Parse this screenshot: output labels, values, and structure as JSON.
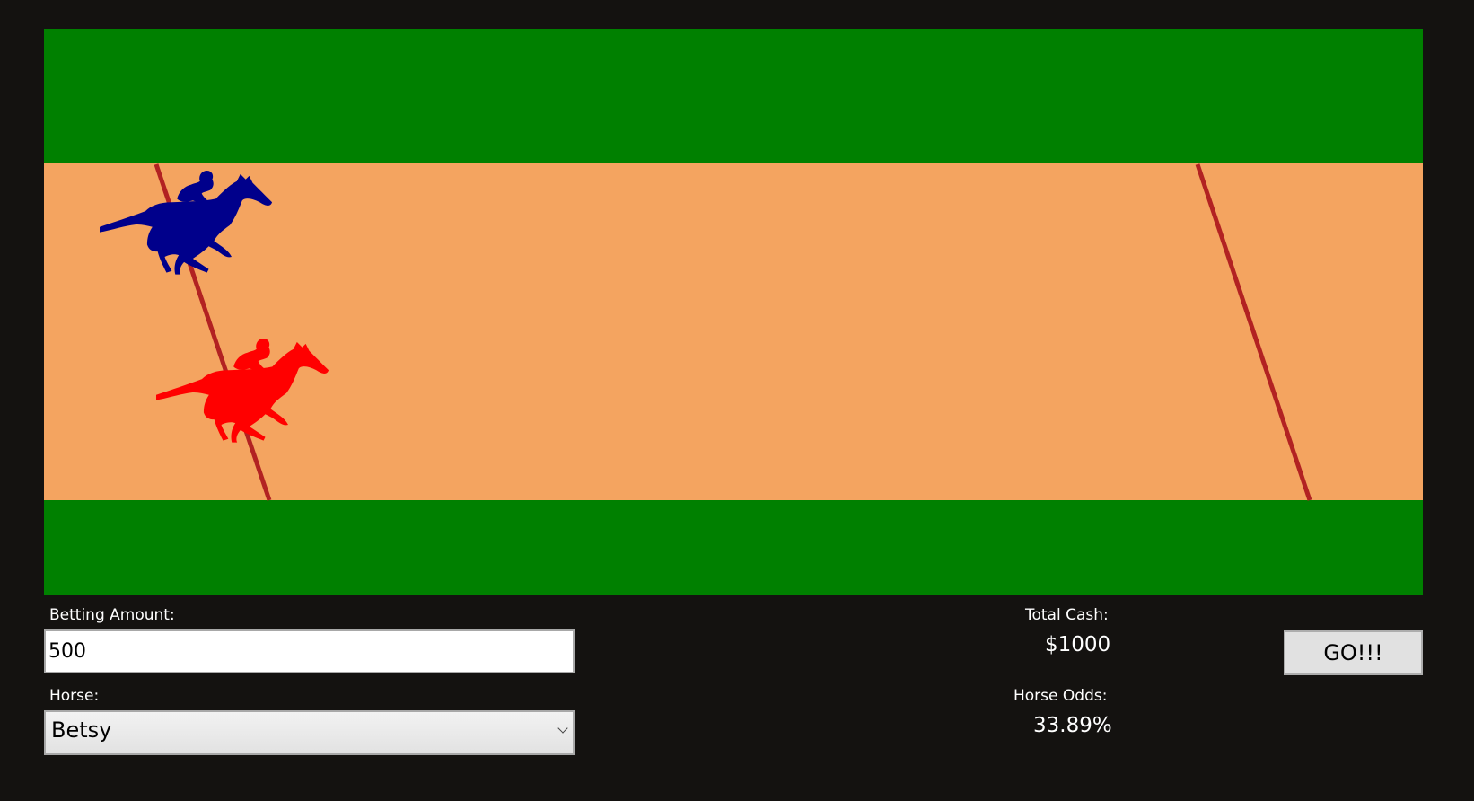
{
  "race_track": {
    "grass_color": "#008000",
    "dirt_color": "#F4A460",
    "line_color": "#B22222",
    "start_line": "start-line",
    "finish_line": "finish-line",
    "horses": [
      {
        "name": "horse-1",
        "color": "#00008B",
        "icon": "horse-with-jockey-icon"
      },
      {
        "name": "horse-2",
        "color": "#FF0000",
        "icon": "horse-with-jockey-icon"
      }
    ]
  },
  "betting": {
    "amount_label": "Betting Amount:",
    "amount_value": "500",
    "horse_label": "Horse:",
    "horse_selected": "Betsy"
  },
  "stats": {
    "total_cash_label": "Total Cash:",
    "total_cash_value": "$1000",
    "horse_odds_label": "Horse Odds:",
    "horse_odds_value": "33.89%"
  },
  "actions": {
    "go_label": "GO!!!"
  }
}
